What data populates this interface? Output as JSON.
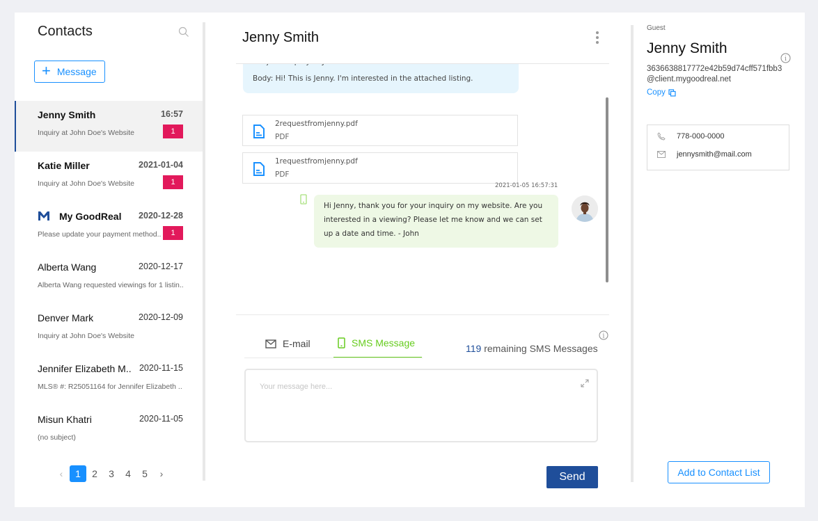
{
  "contacts": {
    "title": "Contacts",
    "new_message_label": "Message",
    "items": [
      {
        "name": "Jenny Smith",
        "date": "16:57",
        "subject": "Inquiry at John Doe's Website",
        "unread": "1"
      },
      {
        "name": "Katie Miller",
        "date": "2021-01-04",
        "subject": "Inquiry at John Doe's Website",
        "unread": "1"
      },
      {
        "name": "My GoodReal",
        "date": "2020-12-28",
        "subject": "Please update your payment method..",
        "unread": "1"
      },
      {
        "name": "Alberta Wang",
        "date": "2020-12-17",
        "subject": "Alberta Wang requested viewings for 1 listin.."
      },
      {
        "name": "Denver Mark",
        "date": "2020-12-09",
        "subject": "Inquiry at John Doe's Website"
      },
      {
        "name": "Jennifer Elizabeth M..",
        "date": "2020-11-15",
        "subject": "MLS® #: R25051164 for Jennifer Elizabeth .."
      },
      {
        "name": "Misun Khatri",
        "date": "2020-11-05",
        "subject": "(no subject)"
      }
    ],
    "pagination": {
      "current": "1",
      "pages": [
        "1",
        "2",
        "3",
        "4",
        "5"
      ]
    }
  },
  "conversation": {
    "title": "Jenny Smith",
    "incoming": {
      "subject": "Subject: Inquiry at John Doe's Website",
      "body": "Body: Hi! This is Jenny. I'm interested in the attached listing."
    },
    "attachments": [
      {
        "name": "2requestfromjenny.pdf",
        "type": "PDF"
      },
      {
        "name": "1requestfromjenny.pdf",
        "type": "PDF"
      }
    ],
    "outgoing": {
      "timestamp": "2021-01-05 16:57:31",
      "text": "Hi Jenny, thank you for your inquiry on my website. Are you interested in a viewing? Please let me know and we can set up a date and time. - John"
    },
    "tabs": {
      "email": "E-mail",
      "sms": "SMS Message",
      "active": "sms"
    },
    "remaining": {
      "count": "119",
      "label": " remaining SMS Messages"
    },
    "compose_placeholder": "Your message here...",
    "send_label": "Send"
  },
  "guest": {
    "label": "Guest",
    "name": "Jenny Smith",
    "id_email": "3636638817772e42b59d74cff571fbb3@client.mygoodreal.net",
    "copy_label": "Copy",
    "phone": "778-000-0000",
    "email": "jennysmith@mail.com",
    "add_contact_label": "Add to Contact List"
  },
  "colors": {
    "accent": "#1890ff",
    "primary": "#1f4e9a",
    "badge": "#e2195b",
    "sms_green": "#66cc1e",
    "incoming_bubble": "#e6f5fd",
    "outgoing_bubble": "#eef8e5"
  }
}
